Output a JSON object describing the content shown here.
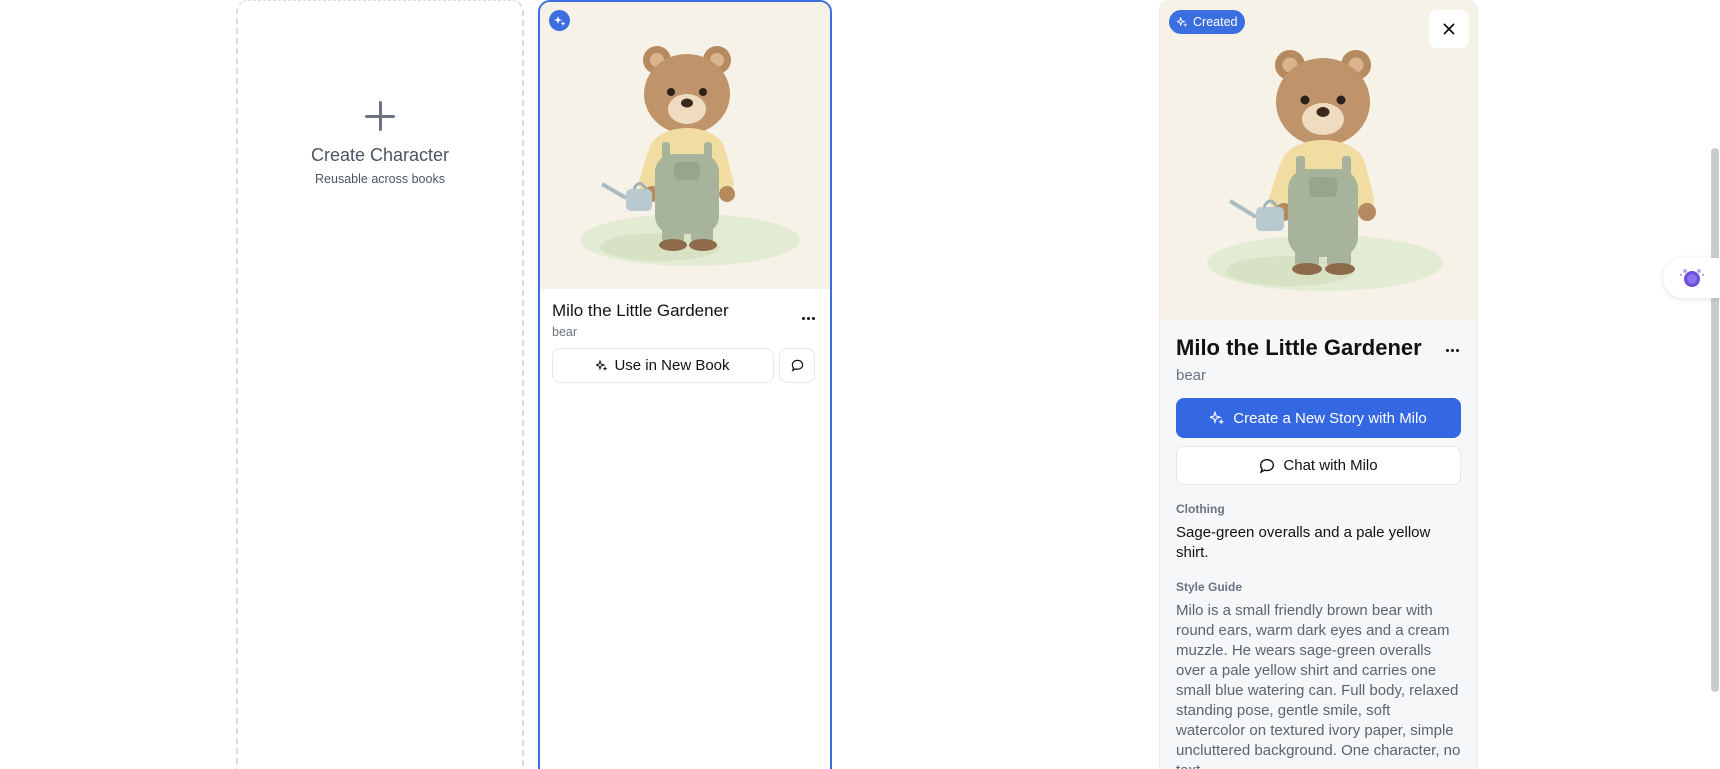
{
  "create_card": {
    "title": "Create Character",
    "subtitle": "Reusable across books"
  },
  "character_card": {
    "name": "Milo the Little Gardener",
    "type": "bear",
    "use_button_label": "Use in New Book"
  },
  "detail": {
    "badge_label": "Created",
    "name": "Milo the Little Gardener",
    "type": "bear",
    "create_story_label": "Create a New Story with Milo",
    "chat_label": "Chat with Milo",
    "clothing_label": "Clothing",
    "clothing_text": "Sage-green overalls and a pale yellow shirt.",
    "style_guide_label": "Style Guide",
    "style_guide_text": "Milo is a small friendly brown bear with round ears, warm dark eyes and a cream muzzle. He wears sage-green overalls over a pale yellow shirt and carries one small blue watering can. Full body, relaxed standing pose, gentle smile, soft watercolor on textured ivory paper, simple uncluttered background. One character, no text."
  },
  "colors": {
    "accent": "#3467e2",
    "selected_border": "#3b6fe0",
    "muted_text": "#6b7280"
  },
  "icons": {
    "plus": "plus-icon",
    "sparkle": "sparkle-icon",
    "chat": "chat-bubble-icon",
    "close": "close-icon",
    "more": "more-icon",
    "assistant": "assistant-icon"
  }
}
